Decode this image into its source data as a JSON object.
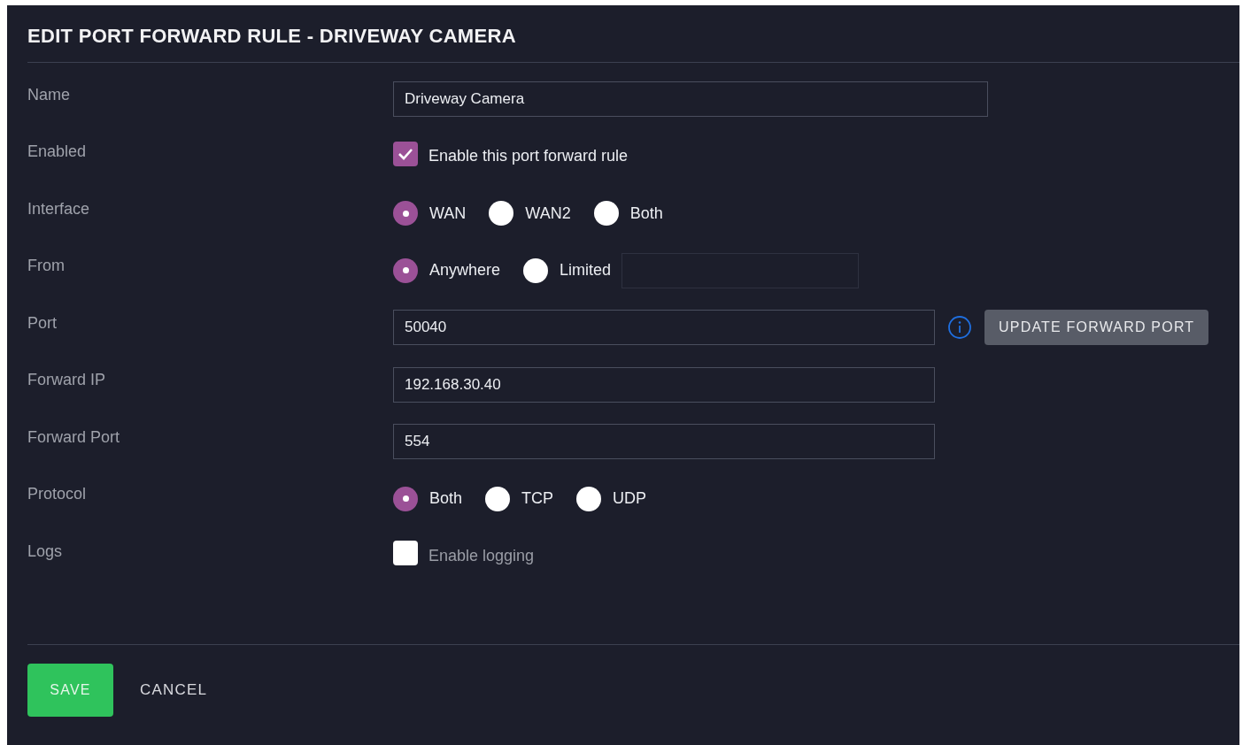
{
  "title": "EDIT PORT FORWARD RULE - DRIVEWAY CAMERA",
  "fields": [
    {
      "label": "Name",
      "kind": "wide_text",
      "value": "Driveway Camera"
    },
    {
      "label": "Enabled",
      "kind": "checkbox",
      "checked": true,
      "text": "Enable this port forward rule"
    },
    {
      "label": "Interface",
      "kind": "radio",
      "options": [
        {
          "label": "WAN",
          "selected": true
        },
        {
          "label": "WAN2",
          "selected": false
        },
        {
          "label": "Both",
          "selected": false
        }
      ]
    },
    {
      "label": "From",
      "kind": "radio_field",
      "options": [
        {
          "label": "Anywhere",
          "selected": true
        },
        {
          "label": "Limited",
          "selected": false
        }
      ]
    },
    {
      "label": "Port",
      "kind": "text_button",
      "value": "50040",
      "button": "UPDATE FORWARD PORT"
    },
    {
      "label": "Forward IP",
      "kind": "text",
      "value": "192.168.30.40"
    },
    {
      "label": "Forward Port",
      "kind": "text",
      "value": "554"
    },
    {
      "label": "Protocol",
      "kind": "radio",
      "options": [
        {
          "label": "Both",
          "selected": true
        },
        {
          "label": "TCP",
          "selected": false
        },
        {
          "label": "UDP",
          "selected": false
        }
      ]
    },
    {
      "label": "Logs",
      "kind": "checkbox",
      "checked": false,
      "text": "Enable logging"
    }
  ],
  "buttons": {
    "save": "SAVE",
    "cancel": "CANCEL"
  }
}
